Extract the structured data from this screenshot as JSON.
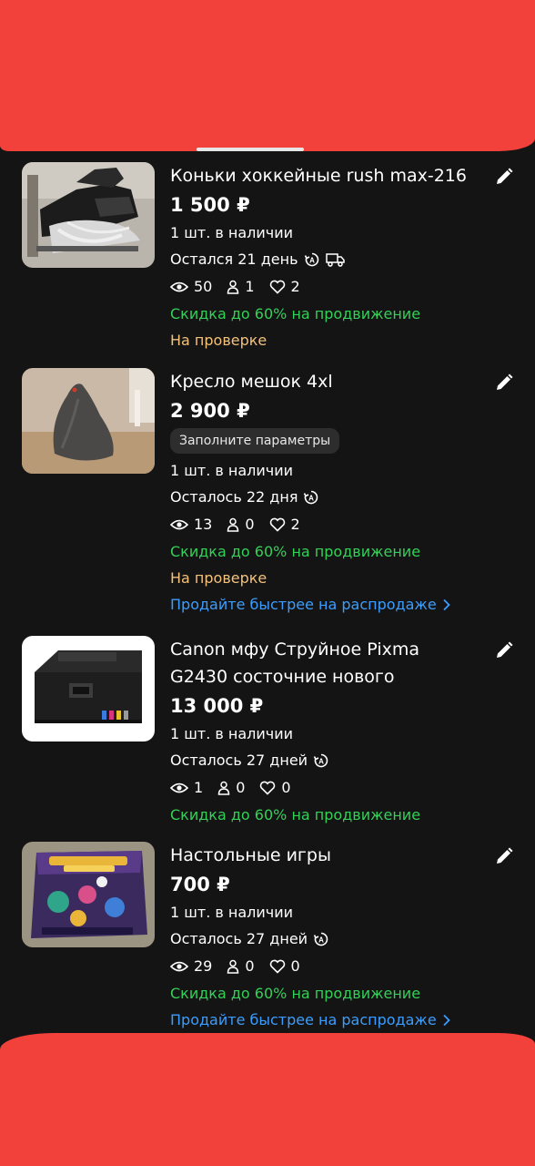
{
  "listings": [
    {
      "title": "Коньки хоккейные rush max-216",
      "price": "1 500 ₽",
      "stock": "1 шт. в наличии",
      "remaining": "Остался 21 день",
      "views": "50",
      "contacts": "1",
      "favorites": "2",
      "promo": "Скидка до 60% на продвижение",
      "status": "На проверке"
    },
    {
      "title": "Кресло мешок 4xl",
      "price": "2 900 ₽",
      "chip": "Заполните параметры",
      "stock": "1 шт. в наличии",
      "remaining": "Осталось 22 дня",
      "views": "13",
      "contacts": "0",
      "favorites": "2",
      "promo": "Скидка до 60% на продвижение",
      "status": "На проверке",
      "sale_link": "Продайте быстрее на распродаже"
    },
    {
      "title_line1": "Canon мфу Струйное Pixma",
      "title_line2": "G2430 состочние нового",
      "price": "13 000 ₽",
      "stock": "1 шт. в наличии",
      "remaining": "Осталось 27 дней",
      "views": "1",
      "contacts": "0",
      "favorites": "0",
      "promo": "Скидка до 60% на продвижение"
    },
    {
      "title": "Настольные игры",
      "price": "700 ₽",
      "stock": "1 шт. в наличии",
      "remaining": "Осталось 27 дней",
      "views": "29",
      "contacts": "0",
      "favorites": "0",
      "promo": "Скидка до 60% на продвижение",
      "sale_link": "Продайте быстрее на распродаже"
    }
  ],
  "colors": {
    "background": "#141414",
    "promo_green": "#34d058",
    "status_orange": "#f4c27a",
    "link_blue": "#3b9dff",
    "redaction_red": "#f2413a"
  },
  "icons": {
    "edit": "pencil-icon",
    "views": "eye-icon",
    "contacts": "person-icon",
    "favorites": "heart-icon",
    "autorenew": "auto-renew-icon",
    "delivery": "truck-icon",
    "chevron": "chevron-right-icon"
  }
}
